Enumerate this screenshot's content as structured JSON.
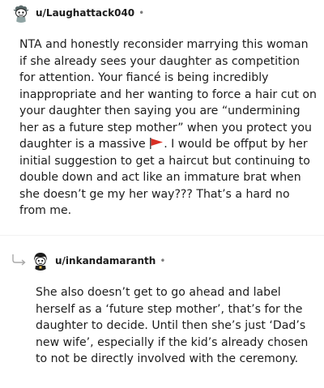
{
  "comments": [
    {
      "username": "u/Laughattack040",
      "separator": "•",
      "avatar_icon": "snoo-avatar-icon",
      "text_before_emoji": "NTA and honestly reconsider marrying this woman if she already sees your daughter as competition for attention. Your fiancé is being incredibly inappropriate and her wanting to force a hair cut on your daughter then saying you are “undermining her as a future step mother” when you protect you daughter is a massive ",
      "emoji": "red-flag-icon",
      "text_after_emoji": ". I would be offput by her initial suggestion to get a haircut but continuing to double down and act like an immature brat when she doesn’t ge my her way??? That’s a hard no from me."
    },
    {
      "username": "u/inkandamaranth",
      "separator": "•",
      "avatar_icon": "snoo-avatar-icon",
      "reply_icon": "reply-arrow-icon",
      "text": "She also doesn’t get to go ahead and label herself as a ‘future step mother’, that’s for the daughter to decide. Until then she’s just ‘Dad’s new wife’, especially if the kid’s already chosen to not be directly involved with the ceremony."
    }
  ],
  "colors": {
    "text": "#1c1c1c",
    "muted": "#7c7c7c",
    "flag_red": "#d93025"
  }
}
